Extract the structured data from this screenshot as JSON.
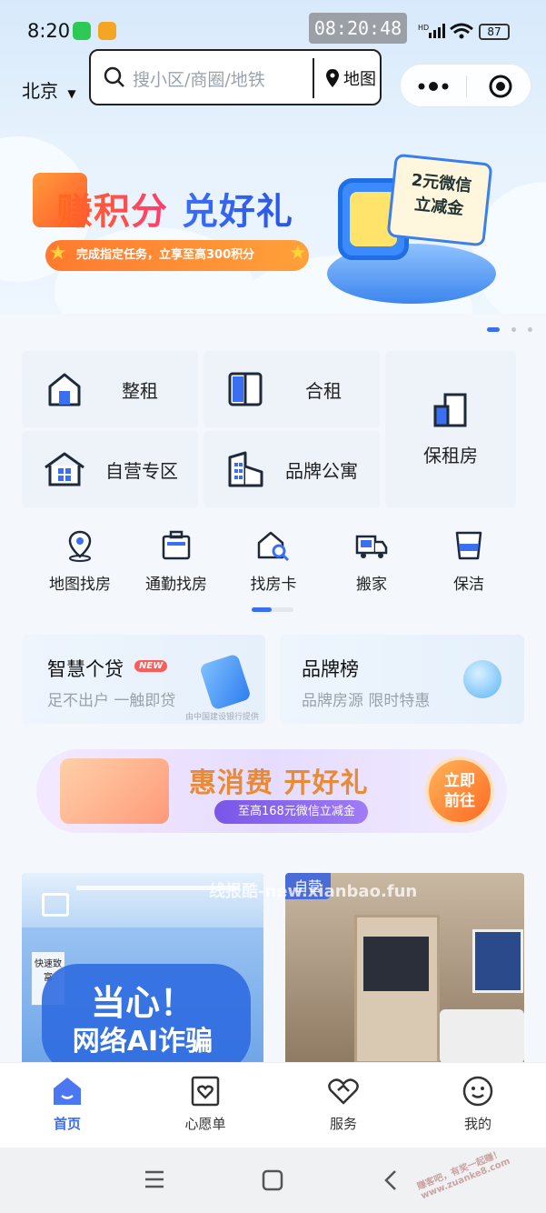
{
  "status": {
    "time": "8:20",
    "clock_box": "08:20:48",
    "battery": "87"
  },
  "header": {
    "city": "北京",
    "search_placeholder": "搜小区/商圈/地铁",
    "map_label": "地图"
  },
  "banner": {
    "title": "赚积分 兑好礼",
    "subtitle": "完成指定任务，立享至高300积分",
    "coupon_line1": "2元微信",
    "coupon_line2": "立减金"
  },
  "categories": [
    {
      "label": "整租",
      "icon": "house-icon"
    },
    {
      "label": "合租",
      "icon": "door-icon"
    },
    {
      "label": "保租房",
      "icon": "building-icon"
    },
    {
      "label": "自营专区",
      "icon": "home-grid-icon"
    },
    {
      "label": "品牌公寓",
      "icon": "apartment-icon"
    }
  ],
  "quick_links": [
    {
      "label": "地图找房",
      "icon": "map-pin-icon"
    },
    {
      "label": "通勤找房",
      "icon": "briefcase-icon"
    },
    {
      "label": "找房卡",
      "icon": "house-search-icon"
    },
    {
      "label": "搬家",
      "icon": "truck-icon"
    },
    {
      "label": "保洁",
      "icon": "bucket-icon"
    }
  ],
  "promos": {
    "loan": {
      "title": "智慧个贷",
      "badge": "NEW",
      "subtitle": "足不出户 一触即贷",
      "note": "由中国建设银行提供"
    },
    "brand": {
      "title": "品牌榜",
      "subtitle": "品牌房源 限时特惠"
    }
  },
  "consumption_banner": {
    "title": "惠消费 开好礼",
    "subtitle": "至高168元微信立减金",
    "cta_line1": "立即",
    "cta_line2": "前往"
  },
  "listings": {
    "left": {
      "line1": "当心！",
      "line2": "网络AI诈骗",
      "sign": "快速致富"
    },
    "right": {
      "tag": "自营"
    }
  },
  "watermark": "线报酷-new.xianbao.fun",
  "corner_watermark": "赚客吧，有奖一起赚！ www.zuanke8.com",
  "tabbar": [
    {
      "label": "首页",
      "icon": "home-icon",
      "active": true
    },
    {
      "label": "心愿单",
      "icon": "heart-card-icon",
      "active": false
    },
    {
      "label": "服务",
      "icon": "handshake-icon",
      "active": false
    },
    {
      "label": "我的",
      "icon": "smile-icon",
      "active": false
    }
  ],
  "colors": {
    "accent": "#3b6ff2",
    "orange": "#ff7a2e"
  }
}
